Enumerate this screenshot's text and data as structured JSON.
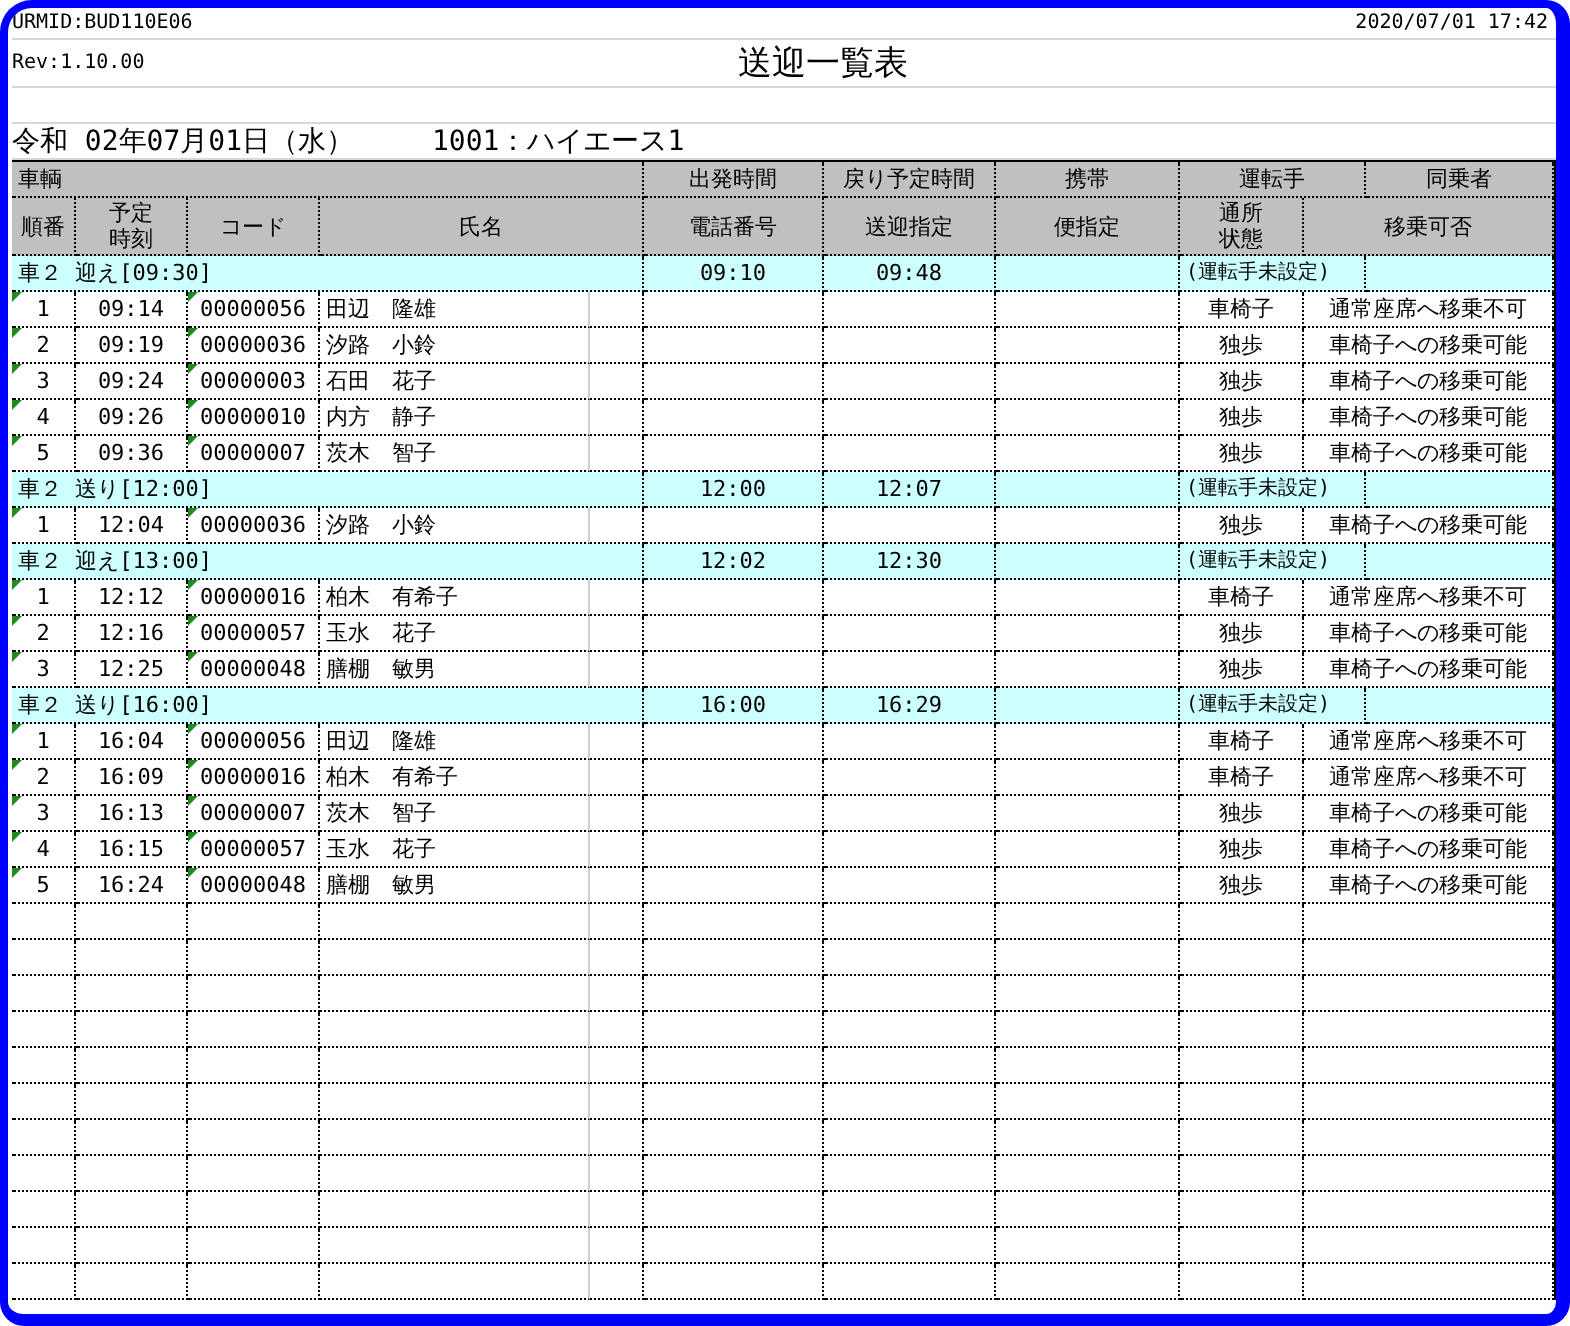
{
  "header": {
    "form_id": "URMID:BUD110E06",
    "timestamp": "2020/07/01 17:42",
    "revision": "Rev:1.10.00",
    "title": "送迎一覧表",
    "date": "令和 02年07月01日（水）",
    "vehicle": "1001：ハイエース1"
  },
  "columns": {
    "top": [
      "車輌",
      "出発時間",
      "戻り予定時間",
      "携帯",
      "運転手",
      "同乗者"
    ],
    "bottom": [
      "順番",
      "予定時刻",
      "コード",
      "氏名",
      "電話番号",
      "送迎指定",
      "便指定",
      "通所状態",
      "移乗可否"
    ]
  },
  "groups": [
    {
      "label": "車２ 迎え[09:30]",
      "departure": "09:10",
      "return": "09:48",
      "driver": "(運転手未設定)",
      "rows": [
        {
          "no": "1",
          "time": "09:14",
          "code": "00000056",
          "name": "田辺　隆雄",
          "status": "車椅子",
          "transfer": "通常座席へ移乗不可"
        },
        {
          "no": "2",
          "time": "09:19",
          "code": "00000036",
          "name": "汐路　小鈴",
          "status": "独歩",
          "transfer": "車椅子への移乗可能"
        },
        {
          "no": "3",
          "time": "09:24",
          "code": "00000003",
          "name": "石田　花子",
          "status": "独歩",
          "transfer": "車椅子への移乗可能"
        },
        {
          "no": "4",
          "time": "09:26",
          "code": "00000010",
          "name": "内方　静子",
          "status": "独歩",
          "transfer": "車椅子への移乗可能"
        },
        {
          "no": "5",
          "time": "09:36",
          "code": "00000007",
          "name": "茨木　智子",
          "status": "独歩",
          "transfer": "車椅子への移乗可能"
        }
      ]
    },
    {
      "label": "車２ 送り[12:00]",
      "departure": "12:00",
      "return": "12:07",
      "driver": "(運転手未設定)",
      "rows": [
        {
          "no": "1",
          "time": "12:04",
          "code": "00000036",
          "name": "汐路　小鈴",
          "status": "独歩",
          "transfer": "車椅子への移乗可能"
        }
      ]
    },
    {
      "label": "車２ 迎え[13:00]",
      "departure": "12:02",
      "return": "12:30",
      "driver": "(運転手未設定)",
      "rows": [
        {
          "no": "1",
          "time": "12:12",
          "code": "00000016",
          "name": "柏木　有希子",
          "status": "車椅子",
          "transfer": "通常座席へ移乗不可"
        },
        {
          "no": "2",
          "time": "12:16",
          "code": "00000057",
          "name": "玉水　花子",
          "status": "独歩",
          "transfer": "車椅子への移乗可能"
        },
        {
          "no": "3",
          "time": "12:25",
          "code": "00000048",
          "name": "膳棚　敏男",
          "status": "独歩",
          "transfer": "車椅子への移乗可能"
        }
      ]
    },
    {
      "label": "車２ 送り[16:00]",
      "departure": "16:00",
      "return": "16:29",
      "driver": "(運転手未設定)",
      "rows": [
        {
          "no": "1",
          "time": "16:04",
          "code": "00000056",
          "name": "田辺　隆雄",
          "status": "車椅子",
          "transfer": "通常座席へ移乗不可"
        },
        {
          "no": "2",
          "time": "16:09",
          "code": "00000016",
          "name": "柏木　有希子",
          "status": "車椅子",
          "transfer": "通常座席へ移乗不可"
        },
        {
          "no": "3",
          "time": "16:13",
          "code": "00000007",
          "name": "茨木　智子",
          "status": "独歩",
          "transfer": "車椅子への移乗可能"
        },
        {
          "no": "4",
          "time": "16:15",
          "code": "00000057",
          "name": "玉水　花子",
          "status": "独歩",
          "transfer": "車椅子への移乗可能"
        },
        {
          "no": "5",
          "time": "16:24",
          "code": "00000048",
          "name": "膳棚　敏男",
          "status": "独歩",
          "transfer": "車椅子への移乗可能"
        }
      ]
    }
  ]
}
